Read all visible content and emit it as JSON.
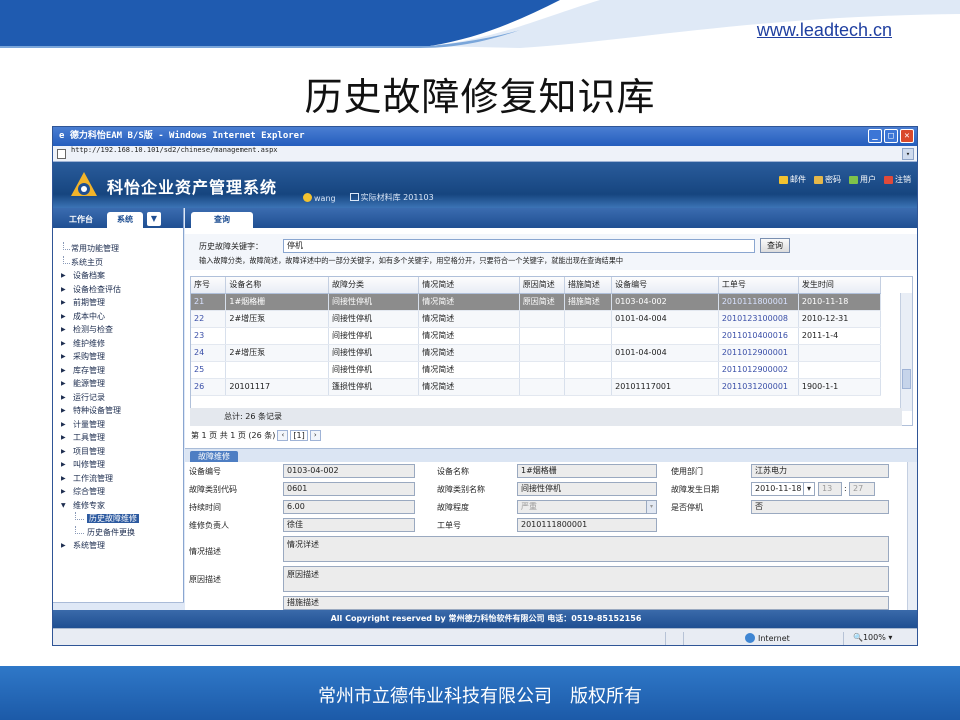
{
  "slide": {
    "url": "www.leadtech.cn",
    "title": "历史故障修复知识库",
    "footer": "常州市立德伟业科技有限公司　版权所有"
  },
  "browser": {
    "title": "德力科怡EAM B/S版 - Windows Internet Explorer",
    "address": "http://192.168.10.101/sd2/chinese/management.aspx",
    "status_zone": "Internet",
    "zoom": "100%"
  },
  "app": {
    "name": "科怡企业资产管理系统",
    "user": "wang",
    "location": "实际材料库 201103",
    "header_links": [
      "邮件",
      "密码",
      "用户",
      "注销"
    ],
    "copyright": "All Copyright reserved by 常州德力科怡软件有限公司 电话：0519-85152156"
  },
  "sidebar": {
    "tabs": [
      "工作台",
      "系统"
    ],
    "items": [
      {
        "label": "常用功能管理",
        "kind": "leaf"
      },
      {
        "label": "系统主页",
        "kind": "leaf"
      },
      {
        "label": "设备档案",
        "kind": "group"
      },
      {
        "label": "设备检查评估",
        "kind": "group"
      },
      {
        "label": "前期管理",
        "kind": "group"
      },
      {
        "label": "成本中心",
        "kind": "group"
      },
      {
        "label": "检测与检查",
        "kind": "group"
      },
      {
        "label": "维护维修",
        "kind": "group"
      },
      {
        "label": "采购管理",
        "kind": "group"
      },
      {
        "label": "库存管理",
        "kind": "group"
      },
      {
        "label": "能源管理",
        "kind": "group"
      },
      {
        "label": "运行记录",
        "kind": "group"
      },
      {
        "label": "特种设备管理",
        "kind": "group"
      },
      {
        "label": "计量管理",
        "kind": "group"
      },
      {
        "label": "工具管理",
        "kind": "group"
      },
      {
        "label": "项目管理",
        "kind": "group"
      },
      {
        "label": "叫修管理",
        "kind": "group"
      },
      {
        "label": "工作流管理",
        "kind": "group"
      },
      {
        "label": "综合管理",
        "kind": "group"
      },
      {
        "label": "维修专家",
        "kind": "open"
      },
      {
        "label": "历史故障维修",
        "kind": "sub",
        "selected": true
      },
      {
        "label": "历史备件更换",
        "kind": "sub"
      },
      {
        "label": "系统管理",
        "kind": "group"
      }
    ]
  },
  "query": {
    "tab": "查询",
    "label": "历史故障关键字：",
    "value": "停机",
    "button": "查询",
    "hint": "输入故障分类，故障简述，故障详述中的一部分关键字，如有多个关键字，用空格分开，只要符合一个关键字，就能出现在查询结果中"
  },
  "grid": {
    "columns": [
      "序号",
      "设备名称",
      "故障分类",
      "情况简述",
      "原因简述",
      "措施简述",
      "设备编号",
      "工单号",
      "发生时间"
    ],
    "rows": [
      [
        "21",
        "1#烟格栅",
        "间接性停机",
        "情况简述",
        "原因简述",
        "措施简述",
        "0103-04-002",
        "2010111800001",
        "2010-11-18"
      ],
      [
        "22",
        "2#增压泵",
        "间接性停机",
        "情况简述",
        "",
        "",
        "0101-04-004",
        "2010123100008",
        "2010-12-31"
      ],
      [
        "23",
        "",
        "间接性停机",
        "情况简述",
        "",
        "",
        "",
        "2011010400016",
        "2011-1-4"
      ],
      [
        "24",
        "2#增压泵",
        "间接性停机",
        "情况简述",
        "",
        "",
        "0101-04-004",
        "2011012900001",
        ""
      ],
      [
        "25",
        "",
        "间接性停机",
        "情况简述",
        "",
        "",
        "",
        "2011012900002",
        ""
      ],
      [
        "26",
        "20101117",
        "篷损性停机",
        "情况简述",
        "",
        "",
        "20101117001",
        "2011031200001",
        "1900-1-1"
      ]
    ],
    "total": "总计: 26 条记录",
    "pager_text": "第 1 页 共 1 页 (26 条)",
    "page": "[1]"
  },
  "detail": {
    "tab": "故障维修",
    "fields": {
      "device_code_label": "设备编号",
      "device_code": "0103-04-002",
      "device_name_label": "设备名称",
      "device_name": "1#烟格栅",
      "dept_label": "使用部门",
      "dept": "江苏电力",
      "fault_type_code_label": "故障类别代码",
      "fault_type_code": "0601",
      "fault_type_name_label": "故障类别名称",
      "fault_type_name": "间接性停机",
      "fault_date_label": "故障发生日期",
      "fault_date": "2010-11-18",
      "fault_hour": "13",
      "fault_min": "27",
      "duration_label": "持续时间",
      "duration": "6.00",
      "severity_label": "故障程度",
      "severity": "严重",
      "stopped_label": "是否停机",
      "stopped": "否",
      "owner_label": "维修负责人",
      "owner": "徐佳",
      "order_label": "工单号",
      "order": "2010111800001",
      "situation_label": "情况描述",
      "situation": "情况详述",
      "cause_label": "原因描述",
      "cause": "原因描述",
      "measure_partial": "措施描述"
    }
  },
  "colors": {
    "accent": "#1f4f92",
    "footer": "#2f78c8",
    "selected_row": "#8c8c8c"
  }
}
